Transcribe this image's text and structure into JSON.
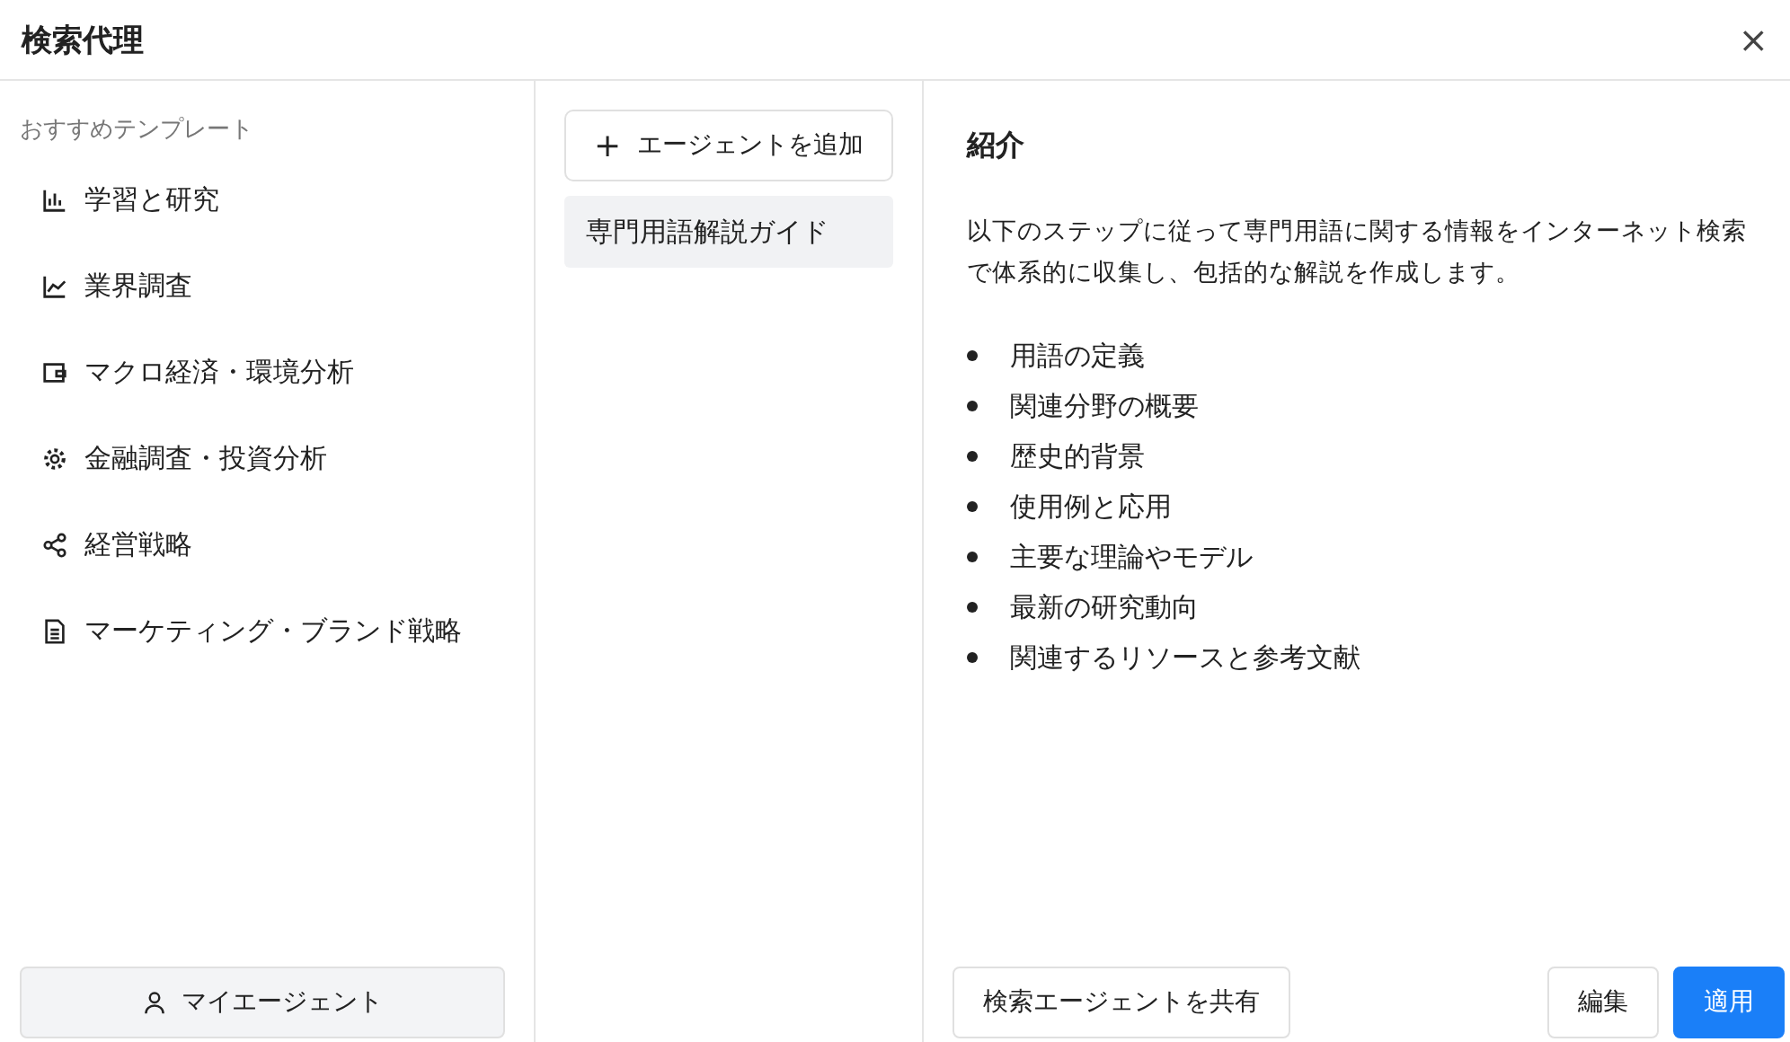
{
  "window": {
    "title": "検索代理",
    "close": "×"
  },
  "sidebar": {
    "heading": "おすすめテンプレート",
    "items": [
      {
        "kind": "bar-chart",
        "label": "学習と研究"
      },
      {
        "kind": "line-chart",
        "label": "業界調査"
      },
      {
        "kind": "wallet",
        "label": "マクロ経済・環境分析"
      },
      {
        "kind": "gear",
        "label": "金融調査・投資分析"
      },
      {
        "kind": "share",
        "label": "経営戦略"
      },
      {
        "kind": "document",
        "label": "マーケティング・ブランド戦略"
      }
    ],
    "my_agents_button": "マイエージェント"
  },
  "agents": {
    "add_button": "エージェントを追加",
    "add_icon": "+",
    "items": [
      {
        "label": "専門用語解説ガイド",
        "selected": true
      }
    ]
  },
  "detail": {
    "title": "紹介",
    "description": "以下のステップに従って専門用語に関する情報をインターネット検索で体系的に収集し、包括的な解説を作成します。",
    "bullets": [
      "用語の定義",
      "関連分野の概要",
      "歴史的背景",
      "使用例と応用",
      "主要な理論やモデル",
      "最新の研究動向",
      "関連するリソースと参考文献"
    ],
    "share_button": "検索エージェントを共有",
    "edit_button": "編集",
    "apply_button": "適用"
  }
}
